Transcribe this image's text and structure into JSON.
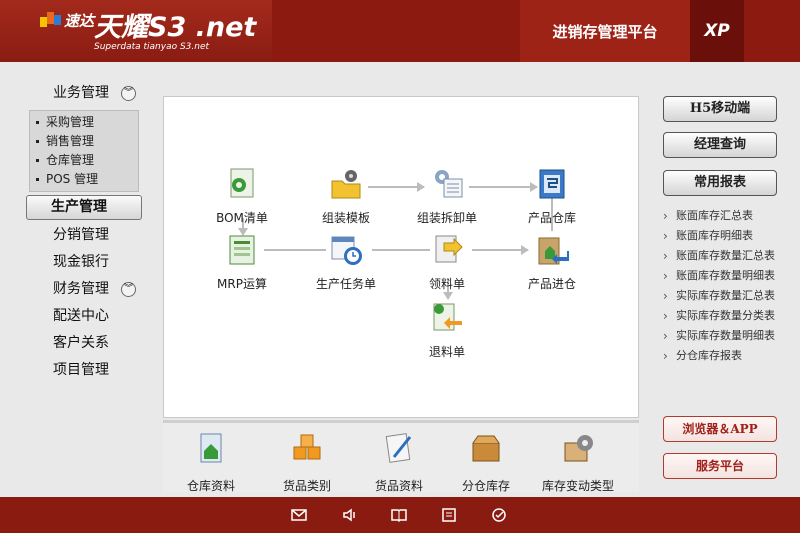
{
  "header": {
    "brand_cn": "速达",
    "title": "天耀S3 .net",
    "subtitle": "Superdata tianyao S3.net",
    "platform": "进销存管理平台",
    "edition": "XP"
  },
  "nav": {
    "business": "业务管理",
    "business_subs": [
      "采购管理",
      "销售管理",
      "仓库管理",
      "POS 管理"
    ],
    "production": "生产管理",
    "distribution": "分销管理",
    "cash": "现金银行",
    "finance": "财务管理",
    "delivery": "配送中心",
    "crm": "客户关系",
    "project": "项目管理"
  },
  "flow": {
    "bom": "BOM清单",
    "assembly_template": "组装模板",
    "assembly_disassembly": "组装拆卸单",
    "product_warehouse": "产品仓库",
    "mrp": "MRP运算",
    "production_task": "生产任务单",
    "material_requisition": "领料单",
    "product_inbound": "产品进仓",
    "material_return": "退料单"
  },
  "shortcuts": [
    "仓库资料",
    "货品类别",
    "货品资料",
    "分仓库存",
    "库存变动类型"
  ],
  "right": {
    "h5": "H5移动端",
    "manager_query": "经理查询",
    "common_reports": "常用报表",
    "reports": [
      "账面库存汇总表",
      "账面库存明细表",
      "账面库存数量汇总表",
      "账面库存数量明细表",
      "实际库存数量汇总表",
      "实际库存数量分类表",
      "实际库存数量明细表",
      "分仓库存报表"
    ],
    "browser_app": "浏览器＆APP",
    "service_platform": "服务平台"
  },
  "footer_icons": [
    "mail-icon",
    "volume-icon",
    "book-icon",
    "list-icon",
    "check-icon"
  ],
  "colors": {
    "header": "#8d1a10",
    "footer": "#8a1b10",
    "accent_red": "#a0201a"
  }
}
